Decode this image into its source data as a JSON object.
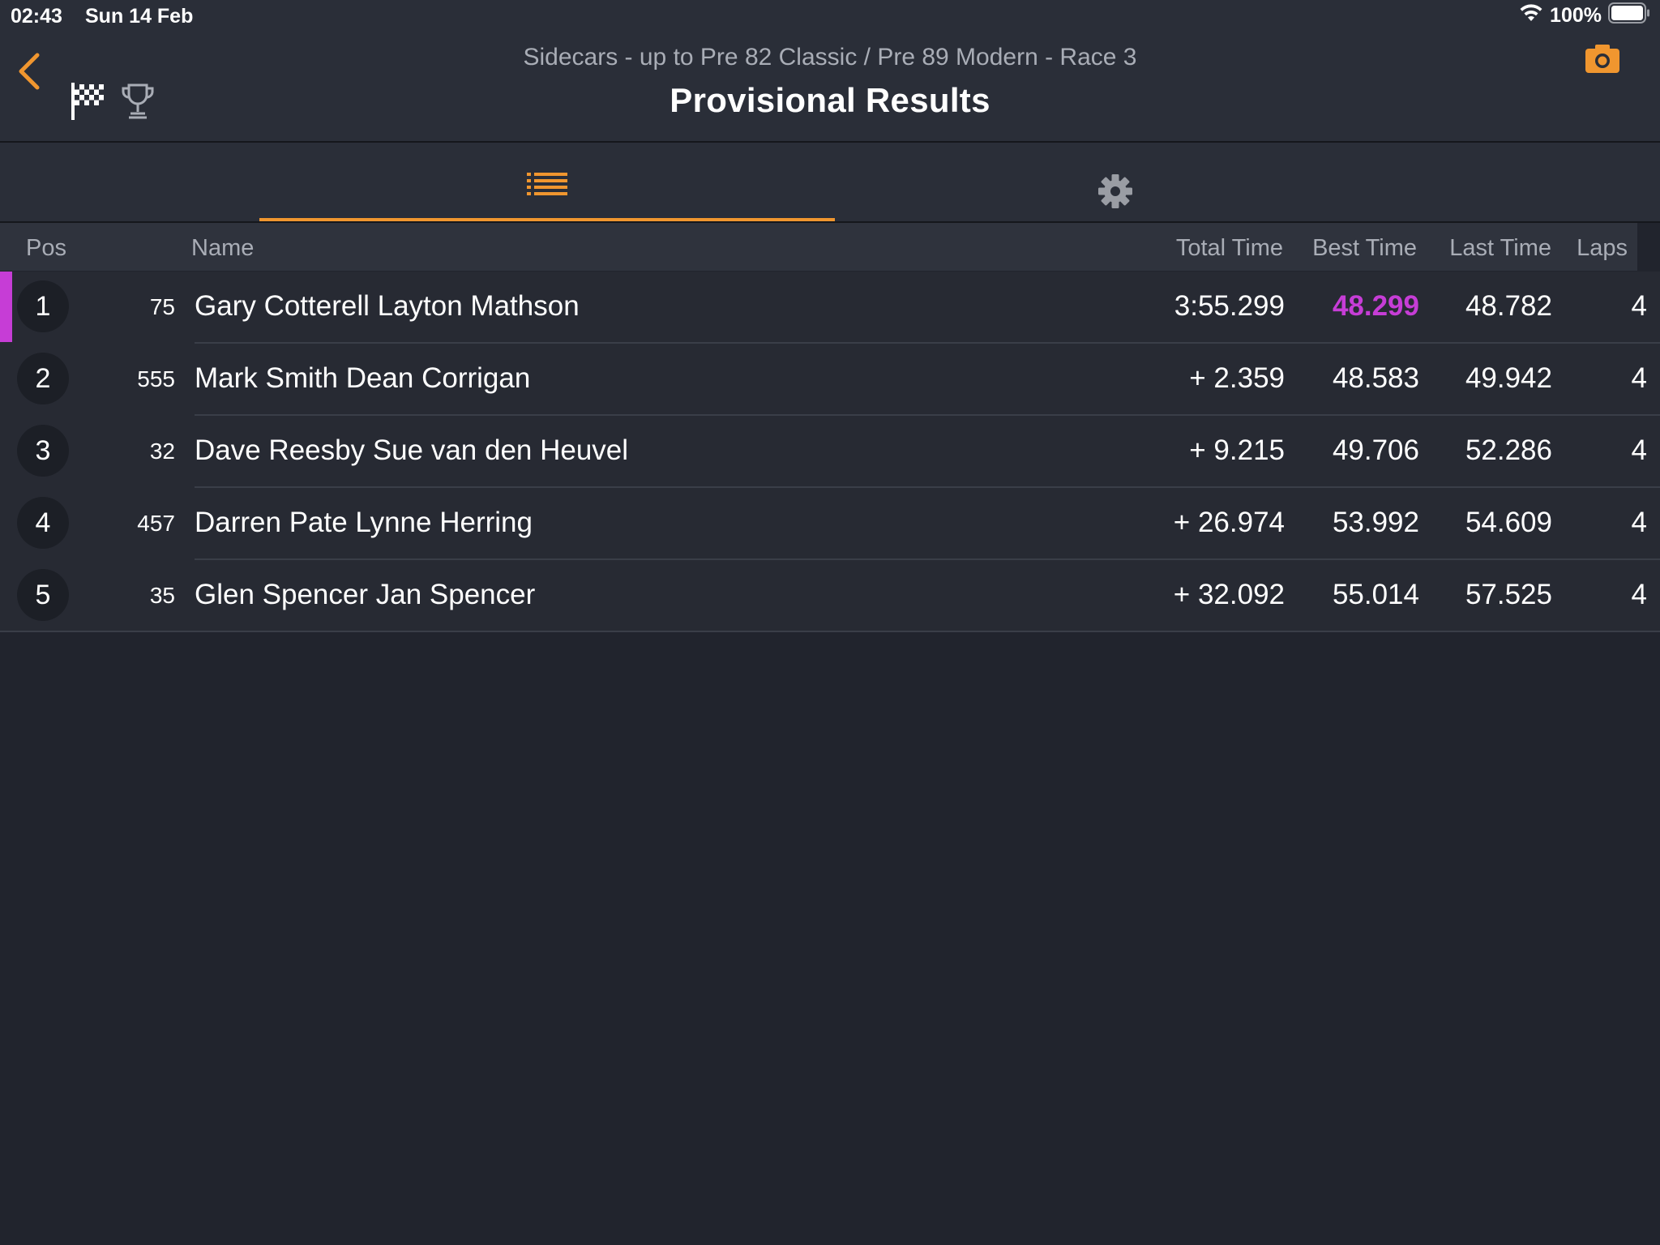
{
  "status_bar": {
    "time": "02:43",
    "date": "Sun 14 Feb",
    "battery": "100%"
  },
  "header": {
    "subtitle": "Sidecars - up to Pre 82 Classic / Pre 89 Modern - Race 3",
    "title": "Provisional Results",
    "icons": [
      "chevron-left-icon",
      "checkered-flag-icon",
      "trophy-icon",
      "camera-icon"
    ]
  },
  "tabs": [
    {
      "icon": "list-icon",
      "active": true
    },
    {
      "icon": "gear-icon",
      "active": false
    }
  ],
  "table": {
    "headers": {
      "pos": "Pos",
      "name": "Name",
      "total": "Total Time",
      "best": "Best Time",
      "last": "Last Time",
      "laps": "Laps"
    },
    "rows": [
      {
        "pos": "1",
        "num": "75",
        "name": "Gary Cotterell Layton Mathson",
        "total": "3:55.299",
        "best": "48.299",
        "last": "48.782",
        "laps": "4",
        "fastest": true
      },
      {
        "pos": "2",
        "num": "555",
        "name": "Mark Smith Dean Corrigan",
        "total": "+ 2.359",
        "best": "48.583",
        "last": "49.942",
        "laps": "4",
        "fastest": false
      },
      {
        "pos": "3",
        "num": "32",
        "name": "Dave Reesby Sue van den Heuvel",
        "total": "+ 9.215",
        "best": "49.706",
        "last": "52.286",
        "laps": "4",
        "fastest": false
      },
      {
        "pos": "4",
        "num": "457",
        "name": "Darren Pate Lynne Herring",
        "total": "+ 26.974",
        "best": "53.992",
        "last": "54.609",
        "laps": "4",
        "fastest": false
      },
      {
        "pos": "5",
        "num": "35",
        "name": "Glen Spencer Jan Spencer",
        "total": "+ 32.092",
        "best": "55.014",
        "last": "57.525",
        "laps": "4",
        "fastest": false
      }
    ]
  },
  "colors": {
    "accent": "#f0962f",
    "fastest_lap": "#c63dd6",
    "background": "#21242d",
    "header_bg": "#2a2e38"
  }
}
